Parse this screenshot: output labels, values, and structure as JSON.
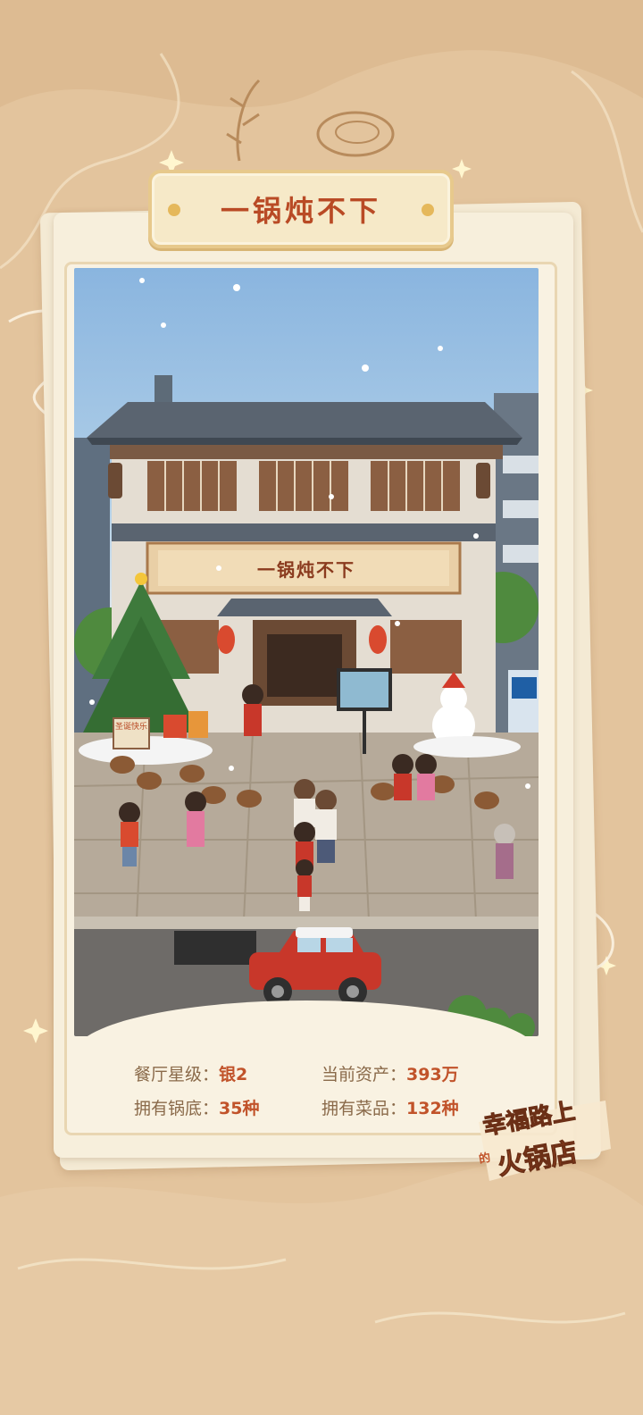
{
  "title": "一锅炖不下",
  "shop_sign": "一锅炖不下",
  "sign_text": "圣诞快乐",
  "stats": [
    {
      "label": "餐厅星级：",
      "value": "银2"
    },
    {
      "label": "当前资产：",
      "value": "393万"
    },
    {
      "label": "拥有锅底：",
      "value": "35种"
    },
    {
      "label": "拥有菜品：",
      "value": "132种"
    }
  ],
  "logo": {
    "line1": "幸福路上",
    "small": "的",
    "line2": "火锅店"
  },
  "colors": {
    "accent": "#c1532a",
    "label": "#8a6a4a",
    "background": "#e3c49d"
  }
}
